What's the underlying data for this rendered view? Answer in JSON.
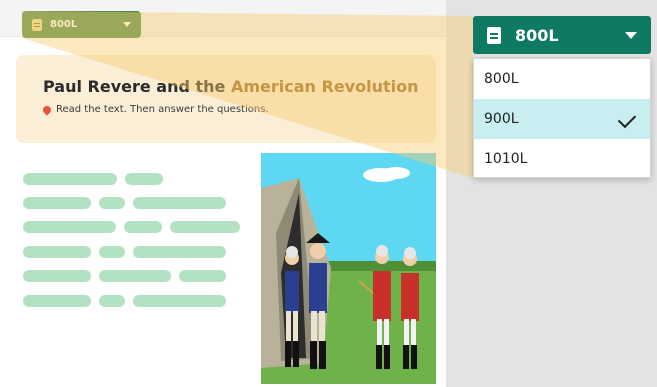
{
  "lesson": {
    "level_chip_label": "800L",
    "title_main": "Paul Revere and the ",
    "title_accent": "American Revolution",
    "instructions": "Read the text. Then answer the questions."
  },
  "level_dropdown": {
    "selected_label": "800L",
    "options": [
      {
        "label": "800L",
        "selected": false
      },
      {
        "label": "900L",
        "selected": true
      },
      {
        "label": "1010L",
        "selected": false
      }
    ]
  },
  "colors": {
    "brand_teal": "#0f7a63",
    "chip_green": "#4e8a4b",
    "header_cream": "#fbeed6",
    "title_accent": "#9b6a1e",
    "placeholder_green": "#b2e2c1",
    "selected_option_bg": "#c9eef1"
  },
  "icons": {
    "level_chip": "book-icon",
    "dropdown": "book-icon",
    "caret": "chevron-down-icon",
    "instructions": "map-pin-icon",
    "selected": "checkmark-icon"
  }
}
